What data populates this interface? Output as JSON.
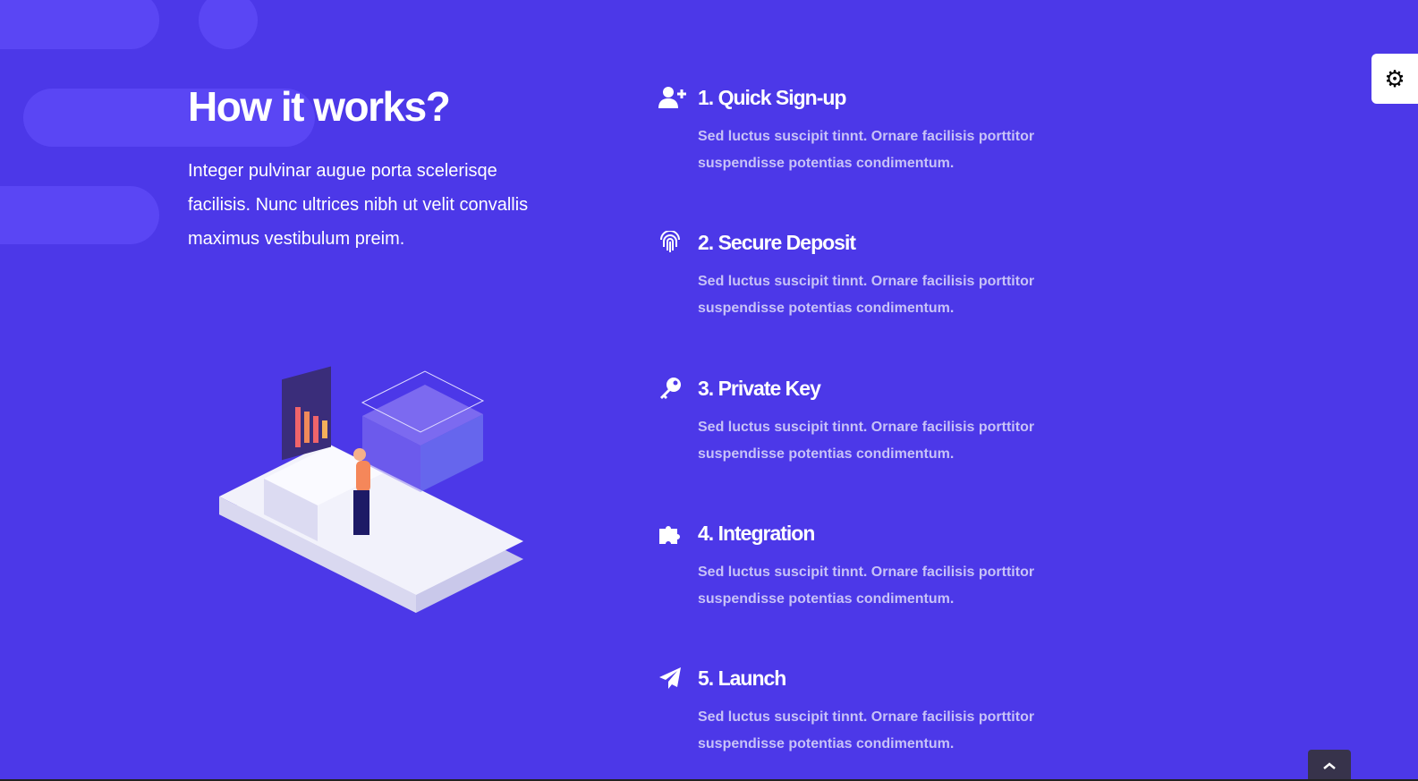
{
  "section": {
    "title": "How it works?",
    "lead": "Integer pulvinar augue porta scelerisqe facilisis. Nunc ultrices nibh ut velit convallis maximus vestibulum preim."
  },
  "steps": [
    {
      "icon": "user-plus-icon",
      "title": "1. Quick Sign-up",
      "text": "Sed luctus suscipit tinnt. Ornare facilisis porttitor suspendisse potentias condimentum."
    },
    {
      "icon": "fingerprint-icon",
      "title": "2. Secure Deposit",
      "text": "Sed luctus suscipit tinnt. Ornare facilisis porttitor suspendisse potentias condimentum."
    },
    {
      "icon": "key-icon",
      "title": "3. Private Key",
      "text": "Sed luctus suscipit tinnt. Ornare facilisis porttitor suspendisse potentias condimentum."
    },
    {
      "icon": "puzzle-icon",
      "title": "4. Integration",
      "text": "Sed luctus suscipit tinnt. Ornare facilisis porttitor suspendisse potentias condimentum."
    },
    {
      "icon": "paper-plane-icon",
      "title": "5. Launch",
      "text": "Sed luctus suscipit tinnt. Ornare facilisis porttitor suspendisse potentias condimentum."
    }
  ],
  "colors": {
    "background": "#4c38e8",
    "muted_text": "#c7c2f7"
  }
}
